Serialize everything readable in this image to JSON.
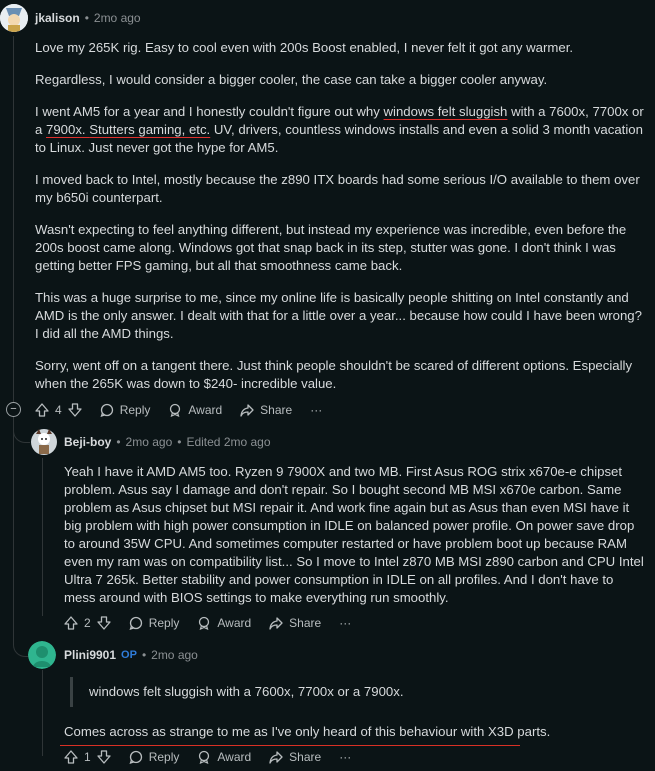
{
  "comments": [
    {
      "username": "jkalison",
      "time": "2mo ago",
      "paragraphs": [
        "Love my 265K rig. Easy to cool even with 200s Boost enabled, I never felt it got any warmer.",
        "Regardless, I would consider a bigger cooler, the case can take a bigger cooler anyway.",
        "I moved back to Intel, mostly because the z890 ITX boards had some serious I/O available to them over my b650i counterpart.",
        "Wasn't expecting to feel anything different, but instead my experience was incredible, even before the 200s boost came along. Windows got that snap back in its step, stutter was gone. I don't think I was getting better FPS gaming, but all that smoothness came back.",
        "This was a huge surprise to me, since my online life is basically people shitting on Intel constantly and AMD is the only answer. I dealt with that for a little over a year... because how could I have been wrong? I did all the AMD things.",
        "Sorry, went off on a tangent there. Just think people shouldn't be scared of different options. Especially when the 265K was down to $240- incredible value."
      ],
      "p3": {
        "a": "I went AM5 for a year and I honestly couldn't figure out why ",
        "u1": "windows felt sluggish",
        "b": " with a 7600x, 7700x or a ",
        "c": "7900x. ",
        "u2": "Stutters gaming, etc.",
        "d": " UV, drivers, countless windows installs and even a solid 3 month vacation to Linux. Just never got the hype for AM5."
      },
      "votes": "4",
      "reply": "Reply",
      "award": "Award",
      "share": "Share",
      "more": "···",
      "collapse": "−"
    },
    {
      "username": "Beji-boy",
      "time": "2mo ago",
      "edited": "Edited 2mo ago",
      "text": "Yeah I have it AMD AM5 too. Ryzen 9 7900X and two MB. First Asus ROG strix x670e-e chipset problem. Asus say I damage and don't repair. So I bought second MB MSI x670e carbon. Same problem as Asus chipset but MSI repair it. And work fine again but as Asus than even MSI have it big problem with high power consumption in IDLE on balanced power profile. On power save drop to around 35W CPU. And sometimes computer restarted or have problem boot up because RAM even my ram was on compatibility list... So I move to Intel z870 MB MSI z890 carbon and CPU Intel Ultra 7 265k. Better stability and power consumption in IDLE on all profiles. And I don't have to mess around with BIOS settings to make everything run smoothly.",
      "votes": "2",
      "reply": "Reply",
      "award": "Award",
      "share": "Share",
      "more": "···"
    },
    {
      "username": "Plini9901",
      "badge": "OP",
      "time": "2mo ago",
      "quote": "windows felt sluggish with a 7600x, 7700x or a 7900x.",
      "text": "Comes across as strange to me as I've only heard of this behaviour with X3D parts.",
      "votes": "1",
      "reply": "Reply",
      "award": "Award",
      "share": "Share",
      "more": "···"
    }
  ],
  "colors": {
    "background": "#0b1416",
    "text": "#d7dadc",
    "muted": "#8b9093",
    "op": "#2f7cd9",
    "underline": "#e0302c"
  }
}
